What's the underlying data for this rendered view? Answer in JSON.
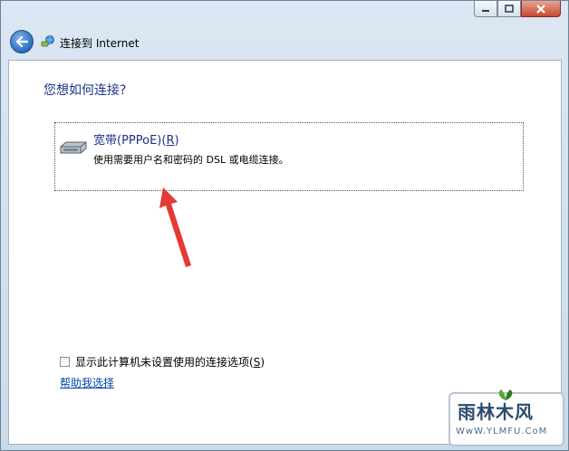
{
  "window": {
    "title": "连接到 Internet",
    "controls": {
      "minimize": "minimize-icon",
      "maximize": "maximize-icon",
      "close": "close-icon"
    }
  },
  "main": {
    "heading": "您想如何连接?",
    "options": [
      {
        "title_prefix": "宽带(PPPoE)(",
        "title_key": "R",
        "title_suffix": ")",
        "description": "使用需要用户名和密码的 DSL 或电缆连接。",
        "icon": "modem-icon"
      }
    ],
    "checkbox": {
      "label_prefix": "显示此计算机未设置使用的连接选项(",
      "label_key": "S",
      "label_suffix": ")",
      "checked": false
    },
    "help_link": "帮助我选择"
  },
  "watermark": {
    "logo": "雨林木风",
    "url": "WwW.YLMFU.CoM"
  },
  "colors": {
    "heading": "#1e3287",
    "link": "#0645ad",
    "arrow": "#e53935",
    "close_button": "#c6492f"
  }
}
